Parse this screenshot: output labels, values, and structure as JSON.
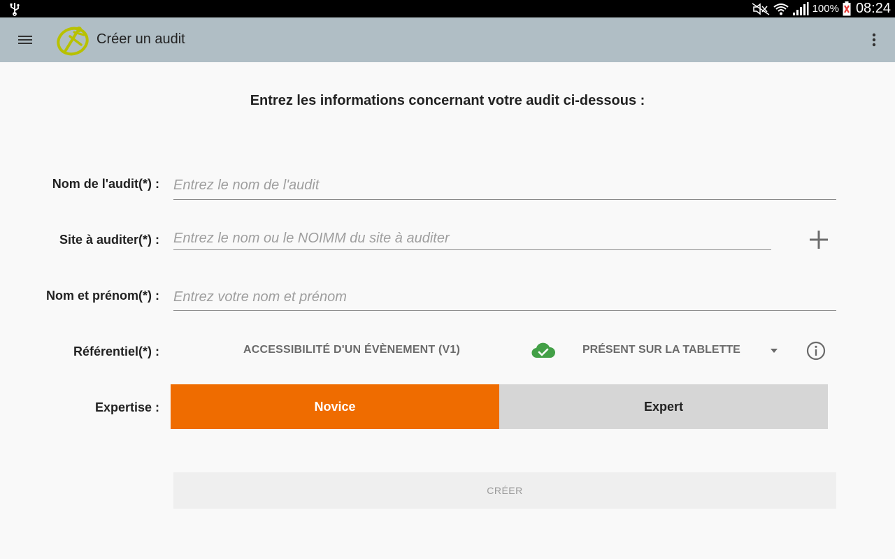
{
  "status_bar": {
    "battery_percent": "100%",
    "time": "08:24"
  },
  "app_bar": {
    "title": "Créer un audit"
  },
  "form": {
    "heading": "Entrez les informations concernant votre audit ci-dessous :",
    "audit_name": {
      "label": "Nom de l'audit(*) :",
      "placeholder": "Entrez le nom de l'audit",
      "value": ""
    },
    "site": {
      "label": "Site à auditer(*) :",
      "placeholder": "Entrez le nom ou le NOIMM du site à auditer",
      "value": ""
    },
    "auditor": {
      "label": "Nom et prénom(*) :",
      "placeholder": "Entrez votre nom et prénom",
      "value": ""
    },
    "referential": {
      "label": "Référentiel(*) :",
      "value": "ACCESSIBILITÉ D'UN ÉVÈNEMENT (V1)",
      "status": "PRÉSENT SUR LA TABLETTE"
    },
    "expertise": {
      "label": "Expertise :",
      "options": [
        "Novice",
        "Expert"
      ],
      "selected": "Novice"
    },
    "create_label": "CRÉER"
  },
  "colors": {
    "app_bar": "#b0bec5",
    "accent_orange": "#ef6c00",
    "cloud_green": "#43a047"
  },
  "icons": {
    "status_bar": [
      "usb-icon",
      "mute-icon",
      "wifi-icon",
      "signal-icon",
      "battery-icon"
    ],
    "app_bar": [
      "menu-icon",
      "app-logo-icon",
      "overflow-menu-icon"
    ],
    "form": [
      "plus-icon",
      "cloud-check-icon",
      "dropdown-caret-icon",
      "info-icon"
    ]
  }
}
